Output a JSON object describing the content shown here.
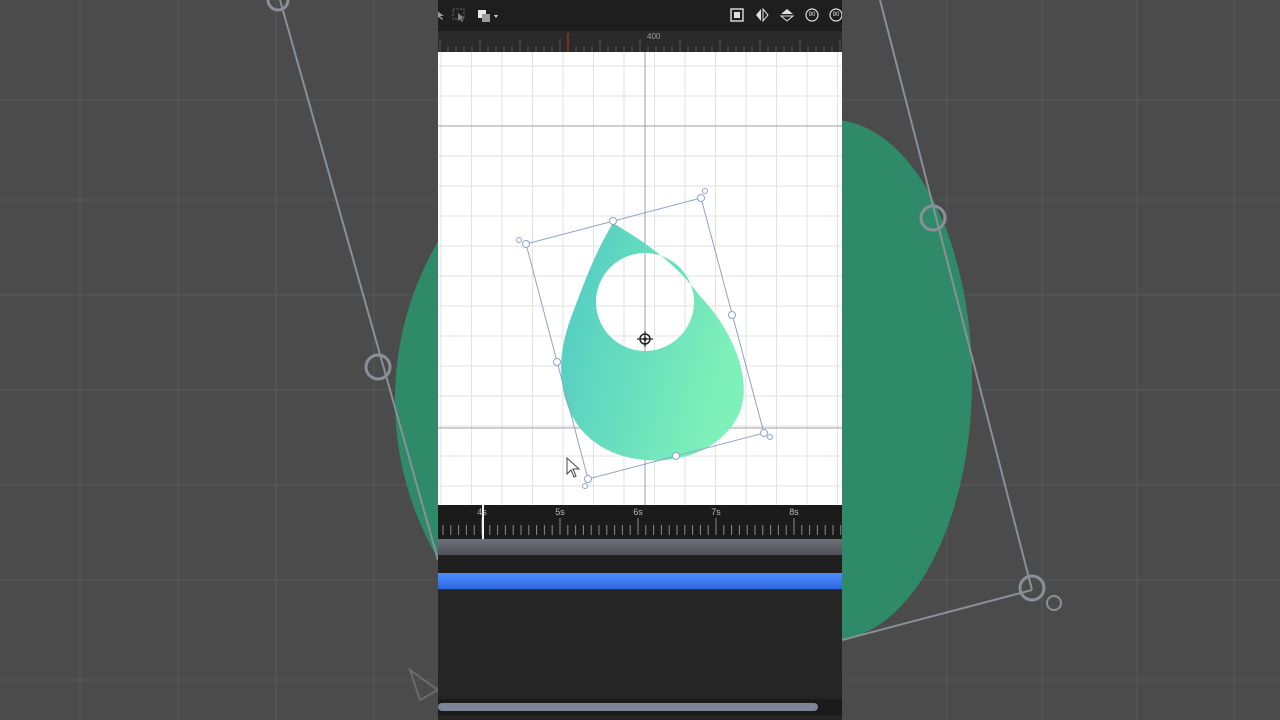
{
  "ruler": {
    "label": "400"
  },
  "toolbar": {
    "left_icons": [
      "select-tool-icon",
      "lasso-select-icon",
      "arrange-icon"
    ],
    "right_icons": [
      "fit-frame-icon",
      "flip-horizontal-icon",
      "flip-vertical-icon",
      "rotate-left-90-icon",
      "rotate-right-90-icon"
    ],
    "rotate_left_label": "90",
    "rotate_right_label": "90"
  },
  "timeline": {
    "ticks": [
      "4s",
      "5s",
      "6s",
      "7s",
      "8s"
    ],
    "track_color": "#3a78f2"
  },
  "shape": {
    "name": "teardrop with circle cutout",
    "gradient_start": "#4fc9c4",
    "gradient_end": "#7ef0b9"
  },
  "colors": {
    "toolbar_bg": "#1e1e1e",
    "canvas_bg": "#ffffff",
    "selection_stroke": "#8ea4c8",
    "background_shape": "#2f8a69"
  }
}
